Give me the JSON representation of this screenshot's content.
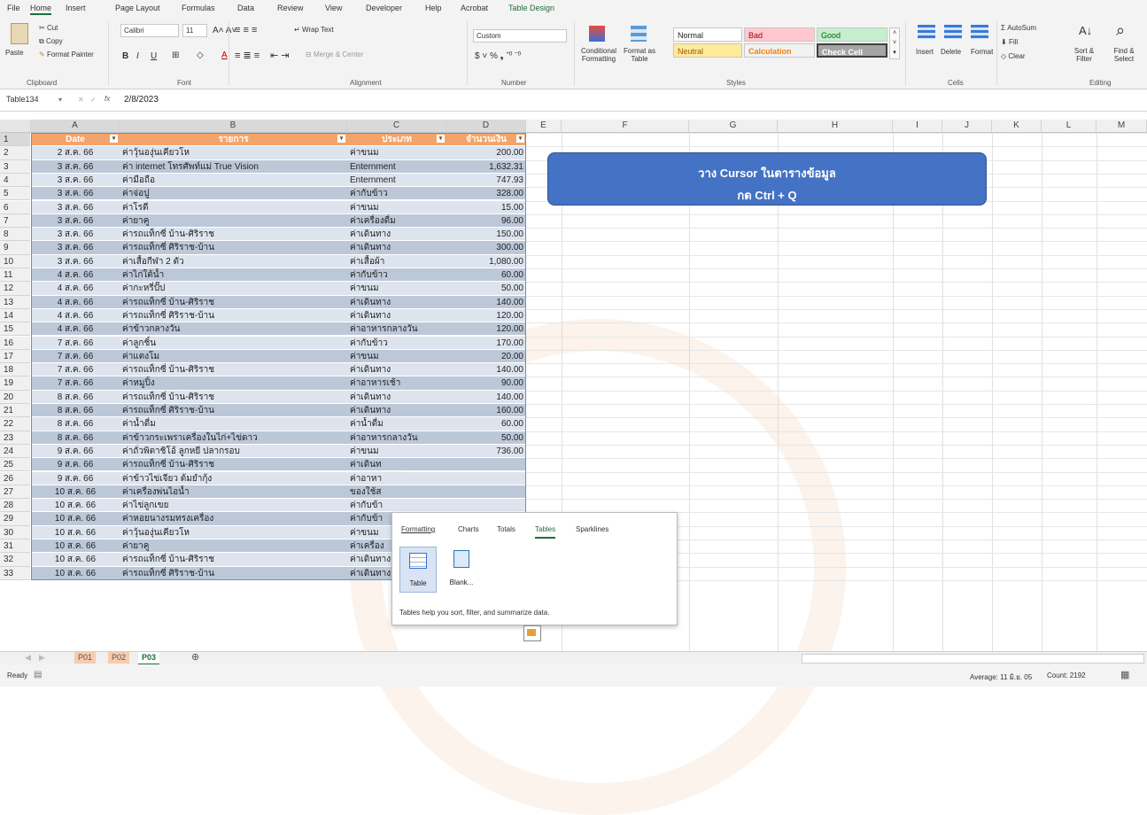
{
  "menu": [
    "File",
    "Home",
    "Insert",
    "Page Layout",
    "Formulas",
    "Data",
    "Review",
    "View",
    "Developer",
    "Help",
    "Acrobat",
    "Table Design"
  ],
  "ribbon": {
    "clipboard": {
      "paste": "Paste",
      "cut": "Cut",
      "copy": "Copy",
      "format_painter": "Format Painter",
      "label": "Clipboard"
    },
    "font": {
      "name": "Calibri",
      "size": "11",
      "label": "Font"
    },
    "alignment": {
      "wrap": "Wrap Text",
      "merge": "Merge & Center",
      "label": "Alignment"
    },
    "number": {
      "format": "Custom",
      "label": "Number"
    },
    "styles": {
      "conditional": "Conditional Formatting",
      "format_as_table": "Format as Table",
      "normal": "Normal",
      "bad": "Bad",
      "good": "Good",
      "neutral": "Neutral",
      "calculation": "Calculation",
      "check_cell": "Check Cell",
      "label": "Styles"
    },
    "cells": {
      "insert": "Insert",
      "delete": "Delete",
      "format": "Format",
      "label": "Cells"
    },
    "editing": {
      "autosum": "AutoSum",
      "fill": "Fill",
      "clear": "Clear",
      "sort": "Sort & Filter",
      "find": "Find & Select",
      "label": "Editing"
    }
  },
  "formula_bar": {
    "name_box": "Table134",
    "fx": "fx",
    "value": "2/8/2023"
  },
  "columns": [
    "A",
    "B",
    "C",
    "D",
    "E",
    "F",
    "G",
    "H",
    "I",
    "J",
    "K",
    "L",
    "M"
  ],
  "table": {
    "headers": [
      "Date",
      "รายการ",
      "ประเภท",
      "จำนวนเงิน"
    ],
    "rows": [
      [
        "2 ส.ค. 66",
        "ค่าวุ้นองุ่นเคียวโห",
        "ค่าขนม",
        "200.00"
      ],
      [
        "3 ส.ค. 66",
        "ค่า internet โทรศัพท์แม่ True Vision",
        "Enternment",
        "1,632.31"
      ],
      [
        "3 ส.ค. 66",
        "ค่ามือถือ",
        "Enternment",
        "747.93"
      ],
      [
        "3 ส.ค. 66",
        "ค่าจ่อปู",
        "ค่ากับข้าว",
        "328.00"
      ],
      [
        "3 ส.ค. 66",
        "ค่าโรตี",
        "ค่าขนม",
        "15.00"
      ],
      [
        "3 ส.ค. 66",
        "ค่ายาคู",
        "ค่าเครื่องดื่ม",
        "96.00"
      ],
      [
        "3 ส.ค. 66",
        "ค่ารถแท็กซี่ บ้าน-ศิริราช",
        "ค่าเดินทาง",
        "150.00"
      ],
      [
        "3 ส.ค. 66",
        "ค่ารถแท็กซี่ ศิริราช-บ้าน",
        "ค่าเดินทาง",
        "300.00"
      ],
      [
        "3 ส.ค. 66",
        "ค่าเสื้อกีฬา 2 ตัว",
        "ค่าเสื้อผ้า",
        "1,080.00"
      ],
      [
        "4 ส.ค. 66",
        "ค่าไก่ใต้น้ำ",
        "ค่ากับข้าว",
        "60.00"
      ],
      [
        "4 ส.ค. 66",
        "ค่ากะหรี่ปั๊ป",
        "ค่าขนม",
        "50.00"
      ],
      [
        "4 ส.ค. 66",
        "ค่ารถแท็กซี่ บ้าน-ศิริราช",
        "ค่าเดินทาง",
        "140.00"
      ],
      [
        "4 ส.ค. 66",
        "ค่ารถแท็กซี่ ศิริราช-บ้าน",
        "ค่าเดินทาง",
        "120.00"
      ],
      [
        "4 ส.ค. 66",
        "ค่าข้าวกลางวัน",
        "ค่าอาหารกลางวัน",
        "120.00"
      ],
      [
        "7 ส.ค. 66",
        "ค่าลูกชิ้น",
        "ค่ากับข้าว",
        "170.00"
      ],
      [
        "7 ส.ค. 66",
        "ค่าแตงโม",
        "ค่าขนม",
        "20.00"
      ],
      [
        "7 ส.ค. 66",
        "ค่ารถแท็กซี่ บ้าน-ศิริราช",
        "ค่าเดินทาง",
        "140.00"
      ],
      [
        "7 ส.ค. 66",
        "ค่าหมูปิ้ง",
        "ค่าอาหารเช้า",
        "90.00"
      ],
      [
        "8 ส.ค. 66",
        "ค่ารถแท็กซี่ บ้าน-ศิริราช",
        "ค่าเดินทาง",
        "140.00"
      ],
      [
        "8 ส.ค. 66",
        "ค่ารถแท็กซี่ ศิริราช-บ้าน",
        "ค่าเดินทาง",
        "160.00"
      ],
      [
        "8 ส.ค. 66",
        "ค่าน้ำดื่ม",
        "ค่าน้ำดื่ม",
        "60.00"
      ],
      [
        "8 ส.ค. 66",
        "ค่าข้าวกระเพราเครื่องในไก่+ไข่ดาว",
        "ค่าอาหารกลางวัน",
        "50.00"
      ],
      [
        "9 ส.ค. 66",
        "ค่าถั่วพิตาชิโอ้ ลูกหยี ปลากรอบ",
        "ค่าขนม",
        "736.00"
      ],
      [
        "9 ส.ค. 66",
        "ค่ารถแท็กซี่ บ้าน-ศิริราช",
        "ค่าเดินท",
        ""
      ],
      [
        "9 ส.ค. 66",
        "ค่าข้าวไข่เจียว ต้มยำกุ้ง",
        "ค่าอาหา",
        ""
      ],
      [
        "10 ส.ค. 66",
        "ค่าเครื่องพ่นไอน้ำ",
        "ของใช้ส",
        ""
      ],
      [
        "10 ส.ค. 66",
        "ค่าไข่ลูกเขย",
        "ค่ากับข้า",
        ""
      ],
      [
        "10 ส.ค. 66",
        "ค่าหอยนางรมทรงเครื่อง",
        "ค่ากับข้า",
        ""
      ],
      [
        "10 ส.ค. 66",
        "ค่าวุ้นองุ่นเคียวโห",
        "ค่าขนม",
        ""
      ],
      [
        "10 ส.ค. 66",
        "ค่ายาคู",
        "ค่าเครื่อง",
        ""
      ],
      [
        "10 ส.ค. 66",
        "ค่ารถแท็กซี่ บ้าน-ศิริราช",
        "ค่าเดินทาง",
        "150.00"
      ],
      [
        "10 ส.ค. 66",
        "ค่ารถแท็กซี่ ศิริราช-บ้าน",
        "ค่าเดินทาง",
        "120.00"
      ]
    ]
  },
  "callout": {
    "line1": "วาง  Cursor ในตารางข้อมูล",
    "line2": "กด Ctrl + Q"
  },
  "quick_analysis": {
    "tabs": [
      "Formatting",
      "Charts",
      "Totals",
      "Tables",
      "Sparklines"
    ],
    "active_tab": "Tables",
    "options": [
      "Table",
      "Blank..."
    ],
    "description": "Tables help you sort, filter, and summarize data."
  },
  "sheets": [
    "P01",
    "P02",
    "P03"
  ],
  "active_sheet": "P03",
  "status": {
    "ready": "Ready",
    "average": "Average: 11 มิ.ย. 05",
    "count": "Count: 2192"
  },
  "colors": {
    "header": "#f3a46b",
    "band_light": "#dde4ee",
    "band_dark": "#bcc8d8",
    "callout": "#4472c4",
    "accent": "#1e6e3a"
  }
}
